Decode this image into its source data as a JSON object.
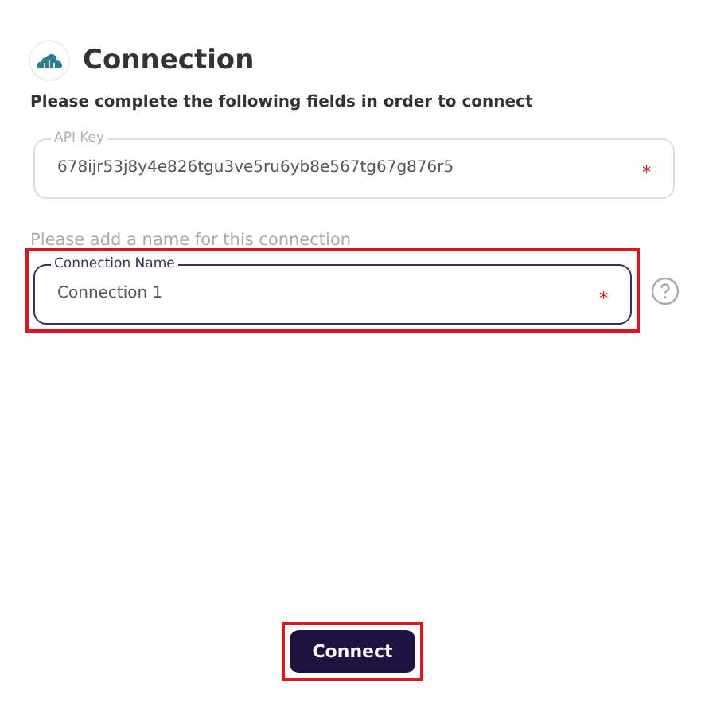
{
  "header": {
    "title": "Connection"
  },
  "instructions": "Please complete the following fields in order to connect",
  "fields": [
    {
      "label": "API Key",
      "value": "678ijr53j8y4e826tgu3ve5ru6yb8e567tg67g876r5",
      "required_mark": "*",
      "focused": false,
      "highlighted": false
    },
    {
      "hint": "Please add a name for this connection",
      "label": "Connection Name",
      "value": "Connection 1",
      "required_mark": "*",
      "focused": true,
      "highlighted": true,
      "help": true
    }
  ],
  "button": {
    "label": "Connect",
    "highlighted": true
  }
}
